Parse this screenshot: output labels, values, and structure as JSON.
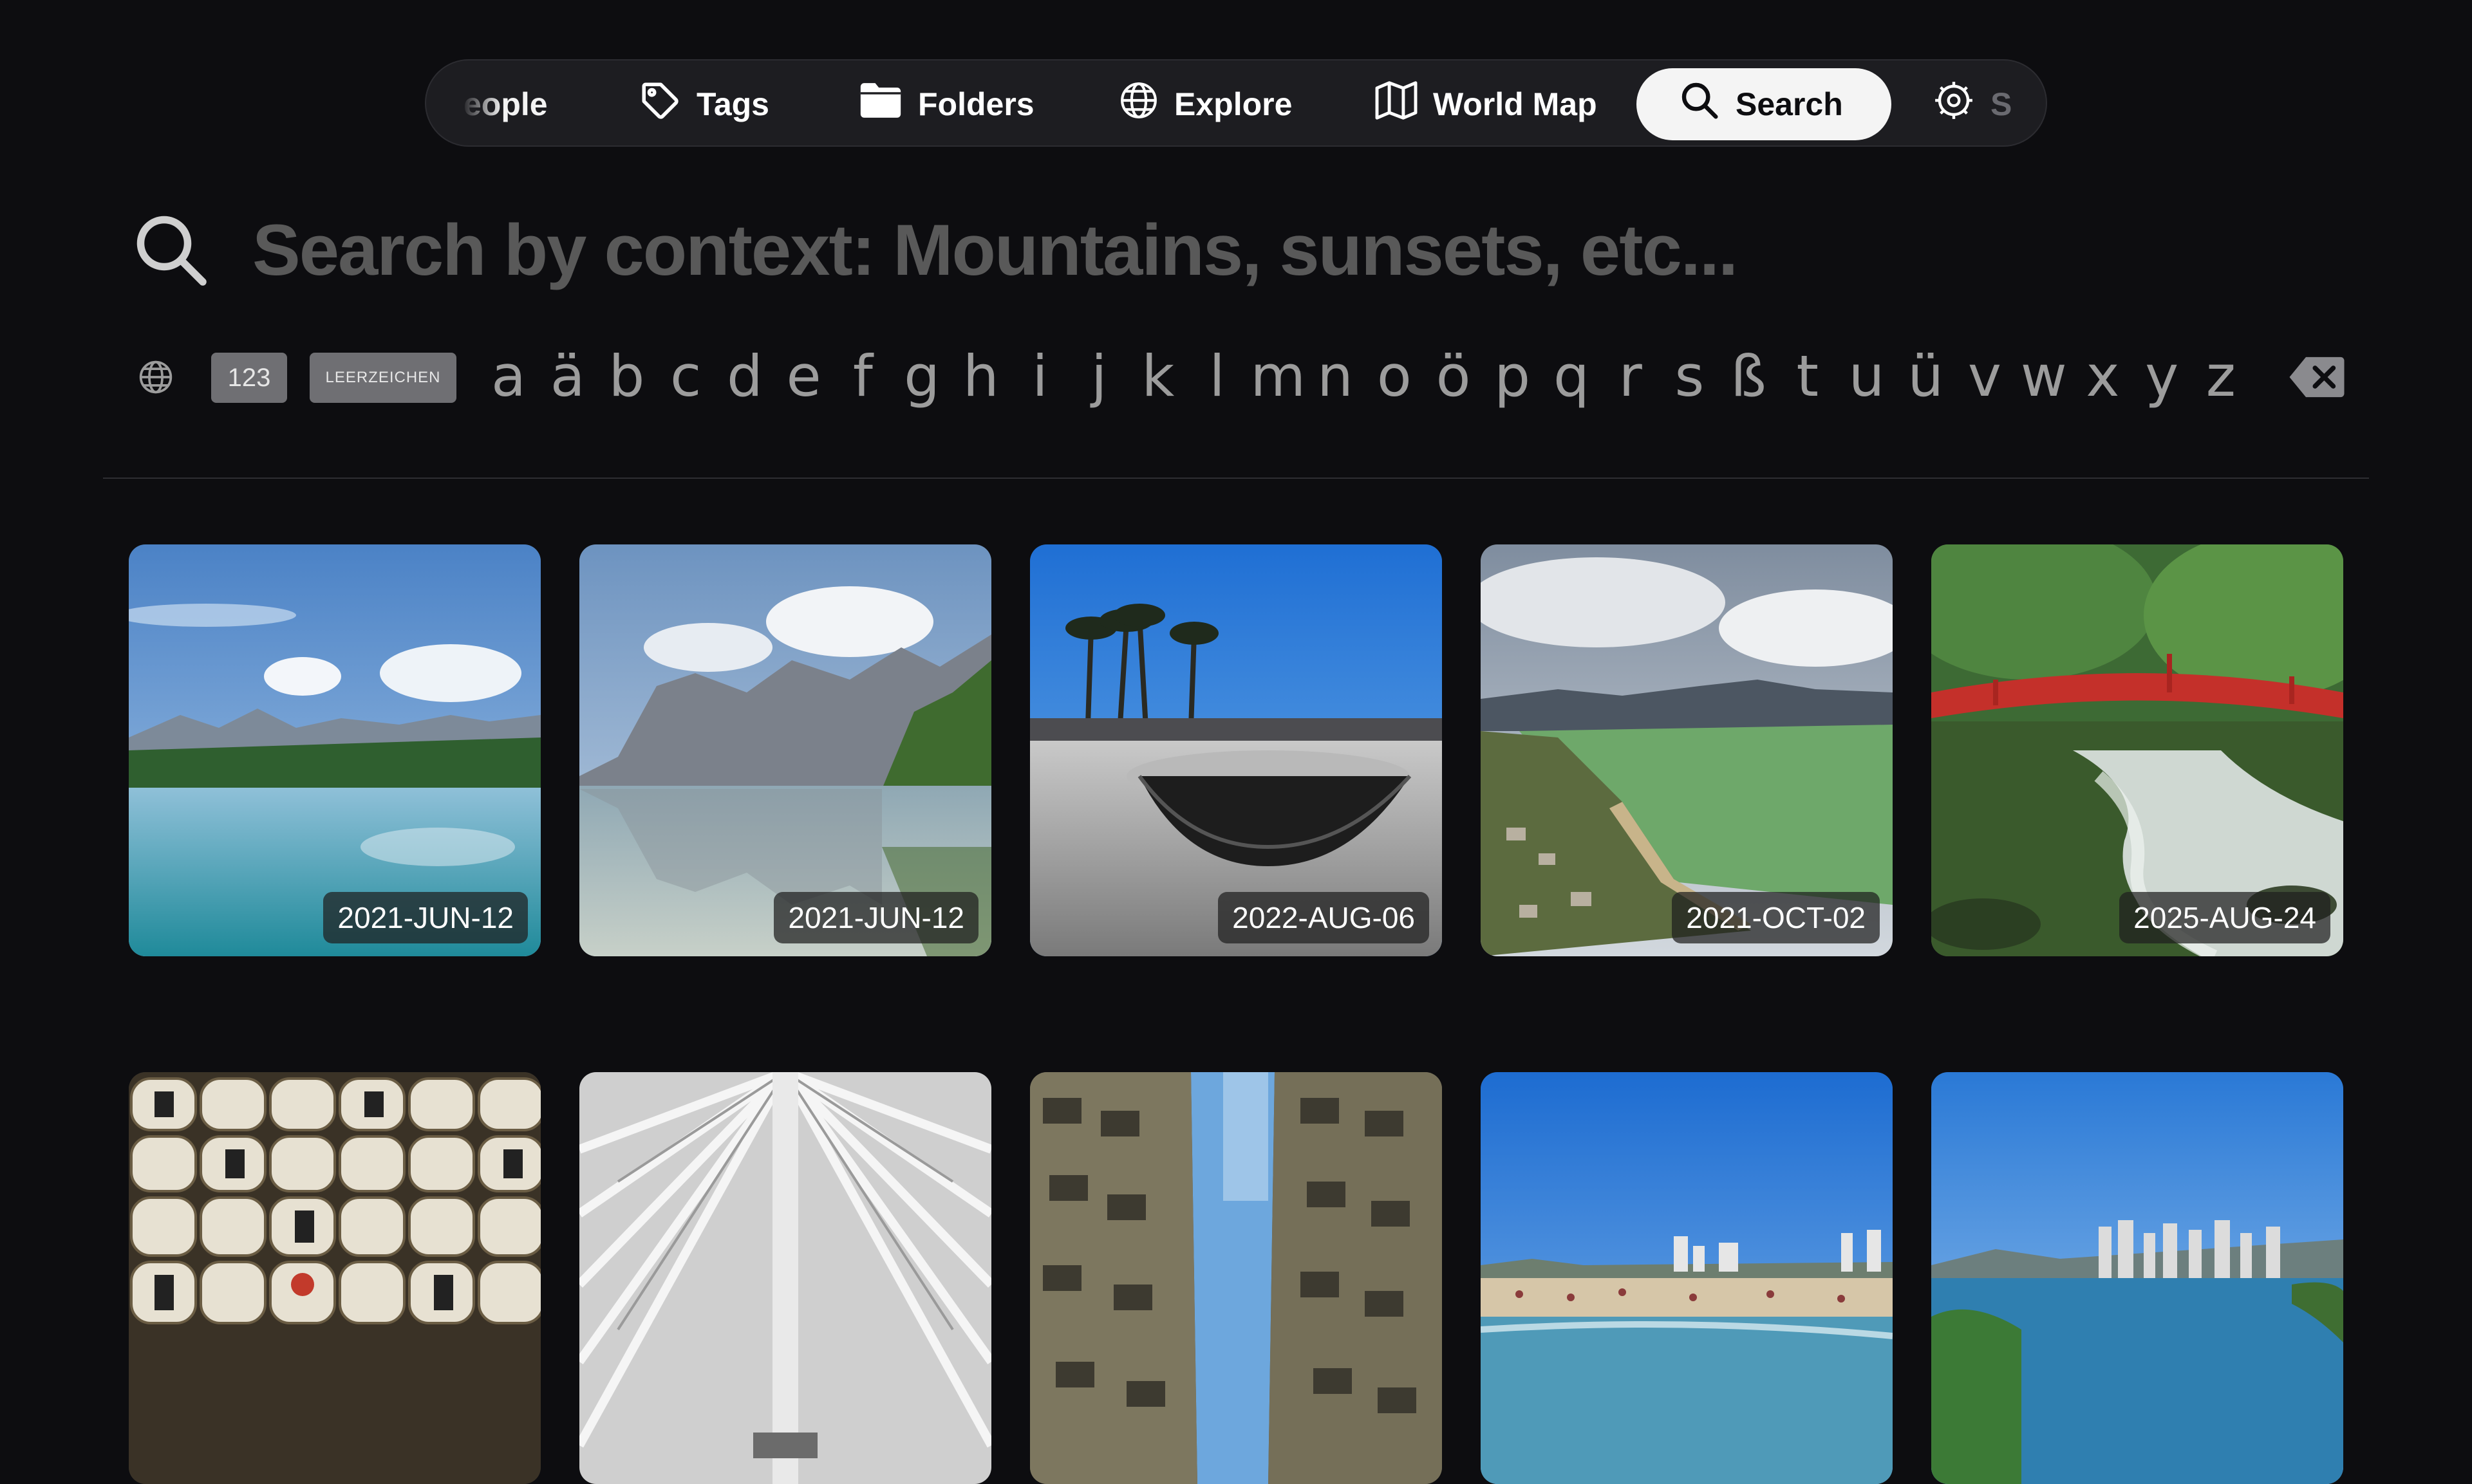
{
  "nav": {
    "items": [
      {
        "label": "eople",
        "icon": "people-icon"
      },
      {
        "label": "Tags",
        "icon": "tag-icon"
      },
      {
        "label": "Folders",
        "icon": "folder-icon"
      },
      {
        "label": "Explore",
        "icon": "globe-icon"
      },
      {
        "label": "World Map",
        "icon": "map-icon"
      },
      {
        "label": "Search",
        "icon": "search-icon",
        "selected": true
      },
      {
        "label": "S",
        "icon": "gear-icon"
      }
    ]
  },
  "search": {
    "placeholder": "Search by context: Mountains, sunsets, etc...",
    "value": ""
  },
  "keyboard": {
    "numbers_key": "123",
    "space_key": "LEERZEICHEN",
    "letters": [
      "a",
      "ä",
      "b",
      "c",
      "d",
      "e",
      "f",
      "g",
      "h",
      "i",
      "j",
      "k",
      "l",
      "m",
      "n",
      "o",
      "ö",
      "p",
      "q",
      "r",
      "s",
      "ß",
      "t",
      "u",
      "ü",
      "v",
      "w",
      "x",
      "y",
      "z"
    ]
  },
  "photos": [
    {
      "date": "2021-JUN-12",
      "scene": "alpine lake"
    },
    {
      "date": "2021-JUN-12",
      "scene": "mountain lake reflection"
    },
    {
      "date": "2022-AUG-06",
      "scene": "skatepark with palm trees"
    },
    {
      "date": "2021-OCT-02",
      "scene": "green lake aerial"
    },
    {
      "date": "2025-AUG-24",
      "scene": "red bridge over river"
    },
    {
      "date": "",
      "scene": "sake barrels"
    },
    {
      "date": "",
      "scene": "white ribbed architecture"
    },
    {
      "date": "",
      "scene": "apartment courtyard"
    },
    {
      "date": "",
      "scene": "beach with city"
    },
    {
      "date": "",
      "scene": "harbor skyline"
    }
  ],
  "colors": {
    "background": "#0d0d10",
    "nav_background": "#1d1d21",
    "selected_tab": "#f4f4f4",
    "placeholder_text": "#595959",
    "key_text": "#9c9c9c"
  }
}
